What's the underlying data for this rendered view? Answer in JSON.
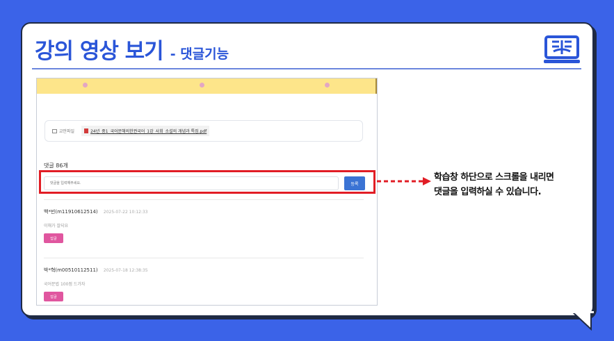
{
  "header": {
    "title_main": "강의 영상 보기",
    "title_sub": "- 댓글기능",
    "icon": "book-icon"
  },
  "screenshot": {
    "attachment": {
      "label": "교안파일",
      "file_name": "24년_중1_국어문해의한권국어_1강_사회_소설의 개념과 특징.pdf"
    },
    "comment_count": "댓글 86개",
    "input": {
      "placeholder": "댓글을 입력해주세요.",
      "submit_label": "등록"
    },
    "comments": [
      {
        "author": "백*빈(m11910612514)",
        "date": "2025-07-22 10:12:33",
        "body": "이해가 잘되요",
        "reply_label": "답글"
      },
      {
        "author": "박*혁(m00510112511)",
        "date": "2025-07-18 12:38:35",
        "body": "국어문법 100점 드가자",
        "reply_label": "답글"
      }
    ]
  },
  "callout": {
    "line1": "학습창 하단으로 스크롤을 내리면",
    "line2": "댓글을 입력하실 수 있습니다."
  },
  "colors": {
    "background": "#3b63e8",
    "accent": "#2a55d8",
    "highlight": "#e11d25",
    "reply": "#e0569f",
    "submit": "#3b73d4"
  }
}
